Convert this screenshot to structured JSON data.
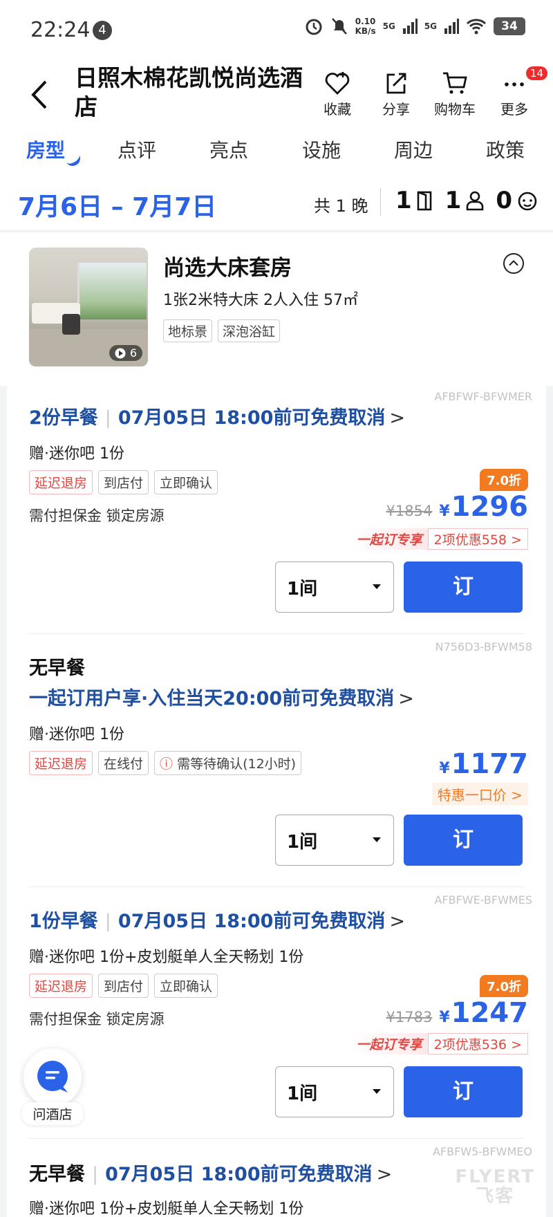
{
  "status": {
    "time": "22:24",
    "notif_count": "4",
    "speed_top": "0.10",
    "speed_unit": "KB/s",
    "net1": "5G",
    "net2": "5G",
    "battery": "34"
  },
  "header": {
    "title": "日照木棉花凯悦尚选酒店",
    "favorite": "收藏",
    "share": "分享",
    "cart": "购物车",
    "more": "更多",
    "more_badge": "14"
  },
  "tabs": [
    "房型",
    "点评",
    "亮点",
    "设施",
    "周边",
    "政策"
  ],
  "datebar": {
    "dates": "7月6日 – 7月7日",
    "nights": "共 1 晚",
    "rooms": "1",
    "adults": "1",
    "children": "0"
  },
  "room": {
    "name": "尚选大床套房",
    "desc": "1张2米特大床  2人入住  57㎡",
    "photo_count": "6",
    "tags": [
      "地标景",
      "深泡浴缸"
    ]
  },
  "rates": [
    {
      "code": "AFBFWF-BFWMER",
      "meal": "2份早餐",
      "cancel": "07月05日 18:00前可免费取消",
      "gift": "赠·迷你吧 1份",
      "tags": [
        "延迟退房",
        "到店付",
        "立即确认"
      ],
      "guarantee": "需付担保金 锁定房源",
      "discount": "7.0折",
      "orig": "¥1854",
      "currency": "¥",
      "price": "1296",
      "promo_label": "一起订专享",
      "promo_coupons": "2项优惠558 >",
      "qty": "1间",
      "book": "订"
    },
    {
      "code": "N756D3-BFWM58",
      "meal": "无早餐",
      "cancel": "一起订用户享·入住当天20:00前可免费取消",
      "gift": "赠·迷你吧 1份",
      "tags": [
        "延迟退房",
        "在线付",
        "需等待确认(12小时)"
      ],
      "currency": "¥",
      "price": "1177",
      "special": "特惠一口价 >",
      "qty": "1间",
      "book": "订"
    },
    {
      "code": "AFBFWE-BFWMES",
      "meal": "1份早餐",
      "cancel": "07月05日 18:00前可免费取消",
      "gift": "赠·迷你吧 1份+皮划艇单人全天畅划 1份",
      "tags": [
        "延迟退房",
        "到店付",
        "立即确认"
      ],
      "guarantee": "需付担保金 锁定房源",
      "discount": "7.0折",
      "orig": "¥1783",
      "currency": "¥",
      "price": "1247",
      "promo_label": "一起订专享",
      "promo_coupons": "2项优惠536 >",
      "qty": "1间",
      "book": "订"
    },
    {
      "code": "AFBFW5-BFWMEO",
      "meal": "无早餐",
      "cancel": "07月05日 18:00前可免费取消",
      "gift": "赠·迷你吧 1份+皮划艇单人全天畅划 1份"
    }
  ],
  "ask_hotel": "问酒店",
  "watermark": "FLYERT\n飞客"
}
